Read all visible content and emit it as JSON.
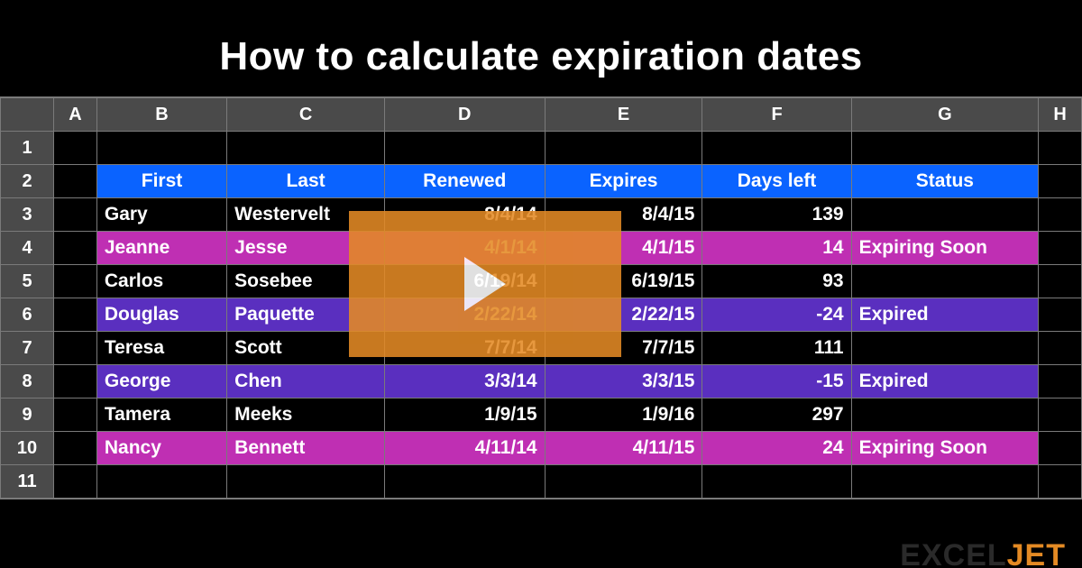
{
  "title": "How to calculate expiration dates",
  "columns": [
    "A",
    "B",
    "C",
    "D",
    "E",
    "F",
    "G",
    "H"
  ],
  "row_numbers": [
    "1",
    "2",
    "3",
    "4",
    "5",
    "6",
    "7",
    "8",
    "9",
    "10",
    "11"
  ],
  "headers": {
    "first": "First",
    "last": "Last",
    "renewed": "Renewed",
    "expires": "Expires",
    "days_left": "Days left",
    "status": "Status"
  },
  "rows": [
    {
      "first": "Gary",
      "last": "Westervelt",
      "renewed": "8/4/14",
      "expires": "8/4/15",
      "days_left": "139",
      "status": "",
      "style": "plain"
    },
    {
      "first": "Jeanne",
      "last": "Jesse",
      "renewed": "4/1/14",
      "expires": "4/1/15",
      "days_left": "14",
      "status": "Expiring Soon",
      "style": "pink"
    },
    {
      "first": "Carlos",
      "last": "Sosebee",
      "renewed": "6/19/14",
      "expires": "6/19/15",
      "days_left": "93",
      "status": "",
      "style": "plain"
    },
    {
      "first": "Douglas",
      "last": "Paquette",
      "renewed": "2/22/14",
      "expires": "2/22/15",
      "days_left": "-24",
      "status": "Expired",
      "style": "purple"
    },
    {
      "first": "Teresa",
      "last": "Scott",
      "renewed": "7/7/14",
      "expires": "7/7/15",
      "days_left": "111",
      "status": "",
      "style": "plain"
    },
    {
      "first": "George",
      "last": "Chen",
      "renewed": "3/3/14",
      "expires": "3/3/15",
      "days_left": "-15",
      "status": "Expired",
      "style": "purple"
    },
    {
      "first": "Tamera",
      "last": "Meeks",
      "renewed": "1/9/15",
      "expires": "1/9/16",
      "days_left": "297",
      "status": "",
      "style": "plain"
    },
    {
      "first": "Nancy",
      "last": "Bennett",
      "renewed": "4/11/14",
      "expires": "4/11/15",
      "days_left": "24",
      "status": "Expiring Soon",
      "style": "pink"
    }
  ],
  "logo_text_a": "EXCEL",
  "logo_text_b": "JET",
  "colors": {
    "header_row": "#0a63ff",
    "pink": "#bf2fb3",
    "purple": "#5a2fbf",
    "overlay": "#e48a24"
  }
}
